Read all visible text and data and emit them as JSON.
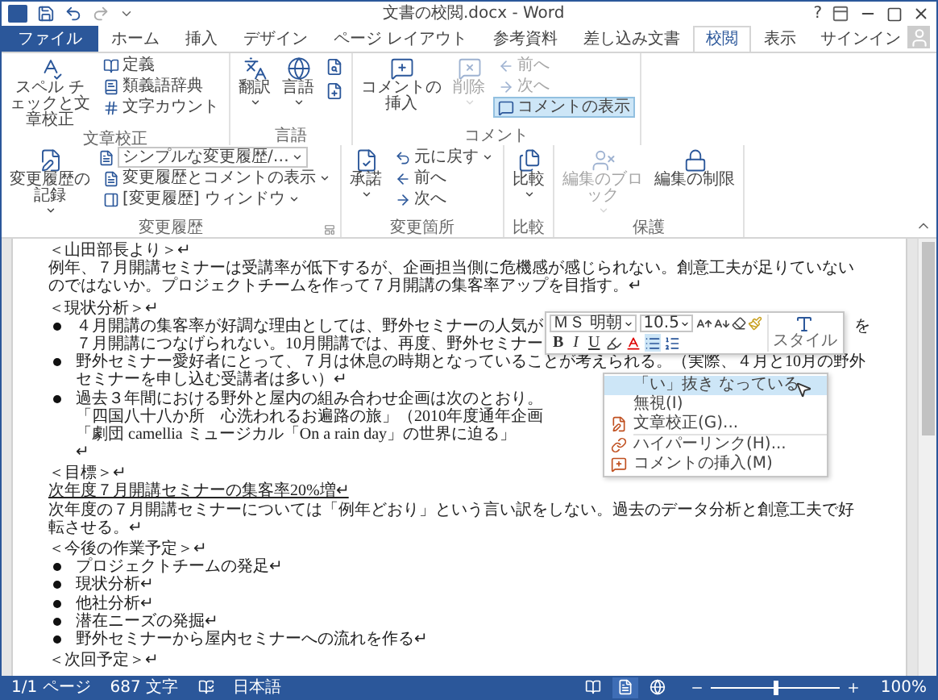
{
  "window": {
    "title": "文書の校閲.docx - Word",
    "help": "?"
  },
  "tabs": [
    {
      "label": "ファイル",
      "kind": "file",
      "selected": false
    },
    {
      "label": "ホーム",
      "kind": "tab",
      "selected": false
    },
    {
      "label": "挿入",
      "kind": "tab",
      "selected": false
    },
    {
      "label": "デザイン",
      "kind": "tab",
      "selected": false
    },
    {
      "label": "ページ レイアウト",
      "kind": "tab",
      "selected": false
    },
    {
      "label": "参考資料",
      "kind": "tab",
      "selected": false
    },
    {
      "label": "差し込み文書",
      "kind": "tab",
      "selected": false
    },
    {
      "label": "校閲",
      "kind": "tab",
      "selected": true
    },
    {
      "label": "表示",
      "kind": "tab",
      "selected": false
    }
  ],
  "account": {
    "label": "サインイン"
  },
  "ribbon": [
    {
      "label": "文章校正",
      "launcher": false,
      "columns": [
        [
          {
            "kind": "large",
            "label": "スペル チェックと文章校正",
            "dropdown": false,
            "disabled": false,
            "on": false
          }
        ],
        [
          {
            "kind": "small",
            "label": "定義",
            "dropdown": false,
            "disabled": false,
            "on": false
          },
          {
            "kind": "small",
            "label": "類義語辞典",
            "dropdown": false,
            "disabled": false,
            "on": false
          },
          {
            "kind": "small",
            "label": "文字カウント",
            "dropdown": false,
            "disabled": false,
            "on": false
          }
        ]
      ]
    },
    {
      "label": "言語",
      "launcher": false,
      "columns": [
        [
          {
            "kind": "large",
            "label": "翻訳",
            "dropdown": true,
            "disabled": false,
            "on": false
          }
        ],
        [
          {
            "kind": "large",
            "label": "言語",
            "dropdown": true,
            "disabled": false,
            "on": false
          }
        ],
        [
          {
            "kind": "icon",
            "disabled": false,
            "on": false
          },
          {
            "kind": "icon",
            "disabled": false,
            "on": false
          }
        ]
      ]
    },
    {
      "label": "コメント",
      "launcher": false,
      "columns": [
        [
          {
            "kind": "large",
            "label": "コメントの挿入",
            "dropdown": false,
            "disabled": false,
            "on": false
          }
        ],
        [
          {
            "kind": "large",
            "label": "削除",
            "dropdown": true,
            "disabled": true,
            "on": false
          }
        ],
        [
          {
            "kind": "small",
            "label": "前へ",
            "dropdown": false,
            "disabled": true,
            "on": false
          },
          {
            "kind": "small",
            "label": "次へ",
            "dropdown": false,
            "disabled": true,
            "on": false
          },
          {
            "kind": "small",
            "label": "コメントの表示",
            "dropdown": false,
            "disabled": false,
            "on": true
          }
        ]
      ]
    },
    {
      "label": "変更履歴",
      "launcher": true,
      "columns": [
        [
          {
            "kind": "large",
            "label": "変更履歴の記録",
            "dropdown": true,
            "disabled": false,
            "on": false
          }
        ],
        [
          {
            "kind": "select",
            "label": "シンプルな変更履歴/…",
            "dropdown": true,
            "disabled": false,
            "on": false
          },
          {
            "kind": "small",
            "label": "変更履歴とコメントの表示",
            "dropdown": true,
            "disabled": false,
            "on": false
          },
          {
            "kind": "small",
            "label": "[変更履歴] ウィンドウ",
            "dropdown": true,
            "disabled": false,
            "on": false
          }
        ]
      ]
    },
    {
      "label": "変更箇所",
      "launcher": false,
      "columns": [
        [
          {
            "kind": "large",
            "label": "承諾",
            "dropdown": true,
            "disabled": false,
            "on": false
          }
        ],
        [
          {
            "kind": "small",
            "label": "元に戻す",
            "dropdown": true,
            "disabled": false,
            "on": false
          },
          {
            "kind": "small",
            "label": "前へ",
            "dropdown": false,
            "disabled": false,
            "on": false
          },
          {
            "kind": "small",
            "label": "次へ",
            "dropdown": false,
            "disabled": false,
            "on": false
          }
        ]
      ]
    },
    {
      "label": "比較",
      "launcher": false,
      "columns": [
        [
          {
            "kind": "large",
            "label": "比較",
            "dropdown": true,
            "disabled": false,
            "on": false
          }
        ]
      ]
    },
    {
      "label": "保護",
      "launcher": false,
      "columns": [
        [
          {
            "kind": "large",
            "label": "編集のブロック",
            "dropdown": true,
            "disabled": true,
            "on": false
          }
        ],
        [
          {
            "kind": "large",
            "label": "編集の制限",
            "dropdown": false,
            "disabled": false,
            "on": false
          }
        ]
      ]
    }
  ],
  "document": {
    "lines": [
      {
        "kind": "heading",
        "text": "＜山田部長より＞↵"
      },
      {
        "kind": "text",
        "text": "例年、７月開講セミナーは受講率が低下するが、企画担当側に危機感が感じられない。創意工夫が足りていない"
      },
      {
        "kind": "text",
        "text": "のではないか。プロジェクトチームを作って７月開講の集客率アップを目指す。↵"
      },
      {
        "kind": "heading",
        "text": "＜現状分析＞↵"
      },
      {
        "kind": "bullet",
        "text": "４月開講の集客率が好調な理由としては、野外セミナーの人気が",
        "tail": "を"
      },
      {
        "kind": "cont",
        "text": "７月開講につなげられない。10月開講では、再度、野外セミナー"
      },
      {
        "kind": "bullet",
        "text": "野外セミナー愛好者にとって、７月は休息の時期となっていることが考えられる。（実際、４月と10月の野外"
      },
      {
        "kind": "cont",
        "text": "セミナーを申し込む受講者は多い）↵"
      },
      {
        "kind": "bullet",
        "text": "過去３年間における野外と屋内の組み合わせ企画は次のとおり。"
      },
      {
        "kind": "cont",
        "text": "「四国八十八か所　心洗われるお遍路の旅」（2010年度通年企画"
      },
      {
        "kind": "cont",
        "text": "「劇団 camellia ミュージカル「On a rain day」の世界に迫る」"
      },
      {
        "kind": "cont",
        "text": "↵"
      },
      {
        "kind": "heading",
        "text": "＜目標＞↵"
      },
      {
        "kind": "text",
        "text": "次年度７月開講セミナーの集客率20%増↵",
        "underline": true
      },
      {
        "kind": "text",
        "text": "次年度の７月開講セミナーについては「例年どおり」という言い訳をしない。過去のデータ分析と創意工夫で好"
      },
      {
        "kind": "text",
        "text": "転させる。↵"
      },
      {
        "kind": "heading",
        "text": "＜今後の作業予定＞↵"
      },
      {
        "kind": "bullet",
        "text": "プロジェクトチームの発足↵"
      },
      {
        "kind": "bullet",
        "text": "現状分析↵"
      },
      {
        "kind": "bullet",
        "text": "他社分析↵"
      },
      {
        "kind": "bullet",
        "text": "潜在ニーズの発掘↵"
      },
      {
        "kind": "bullet",
        "text": "野外セミナーから屋内セミナーへの流れを作る↵"
      },
      {
        "kind": "heading",
        "text": "＜次回予定＞↵"
      }
    ]
  },
  "mini_toolbar": {
    "font": "ＭＳ 明朝",
    "size": "10.5",
    "bold": "B",
    "italic": "I",
    "underline": "U",
    "bullets_on": true,
    "style": "スタイル"
  },
  "context_menu": {
    "items": [
      {
        "kind": "suggestion",
        "label": "「い」抜き なっている",
        "selected": true
      },
      {
        "kind": "plain",
        "label": "無視(I)",
        "selected": false
      },
      {
        "kind": "proof",
        "label": "文章校正(G)...",
        "selected": false
      },
      {
        "kind": "link",
        "label": "ハイパーリンク(H)...",
        "selected": false
      },
      {
        "kind": "comment",
        "label": "コメントの挿入(M)",
        "selected": false
      }
    ]
  },
  "status_bar": {
    "page": "1/1 ページ",
    "words": "687 文字",
    "language": "日本語",
    "views": [
      {
        "selected": false
      },
      {
        "selected": true
      },
      {
        "selected": false
      }
    ],
    "zoom": {
      "level": 0.5,
      "reading": "100%"
    }
  }
}
